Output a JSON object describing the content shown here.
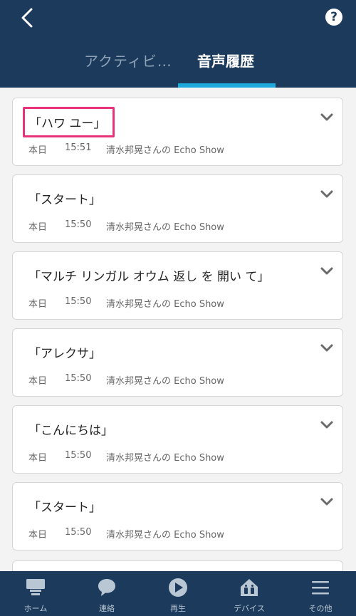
{
  "header": {
    "tabs": [
      {
        "label": "アクティビ…",
        "active": false
      },
      {
        "label": "音声履歴",
        "active": true
      }
    ]
  },
  "history": [
    {
      "utterance": "「ハワ ユー」",
      "date": "本日",
      "time": "15:51",
      "device": "清水邦晃さんの Echo Show",
      "highlighted": true
    },
    {
      "utterance": "「スタート」",
      "date": "本日",
      "time": "15:50",
      "device": "清水邦晃さんの Echo Show"
    },
    {
      "utterance": "「マルチ リンガル オウム 返し を 開い て」",
      "date": "本日",
      "time": "15:50",
      "device": "清水邦晃さんの Echo Show"
    },
    {
      "utterance": "「アレクサ」",
      "date": "本日",
      "time": "15:50",
      "device": "清水邦晃さんの Echo Show"
    },
    {
      "utterance": "「こんにちは」",
      "date": "本日",
      "time": "15:50",
      "device": "清水邦晃さんの Echo Show"
    },
    {
      "utterance": "「スタート」",
      "date": "本日",
      "time": "15:50",
      "device": "清水邦晃さんの Echo Show"
    }
  ],
  "bottom_nav": [
    {
      "label": "ホーム",
      "icon": "home-icon"
    },
    {
      "label": "連絡",
      "icon": "chat-bubble-icon"
    },
    {
      "label": "再生",
      "icon": "play-icon"
    },
    {
      "label": "デバイス",
      "icon": "devices-icon"
    },
    {
      "label": "その他",
      "icon": "menu-icon"
    }
  ],
  "colors": {
    "header_bg": "#1b3a5c",
    "tab_indicator": "#1fa8db",
    "highlight_border": "#e8327a",
    "page_bg": "#f3f3f3"
  }
}
